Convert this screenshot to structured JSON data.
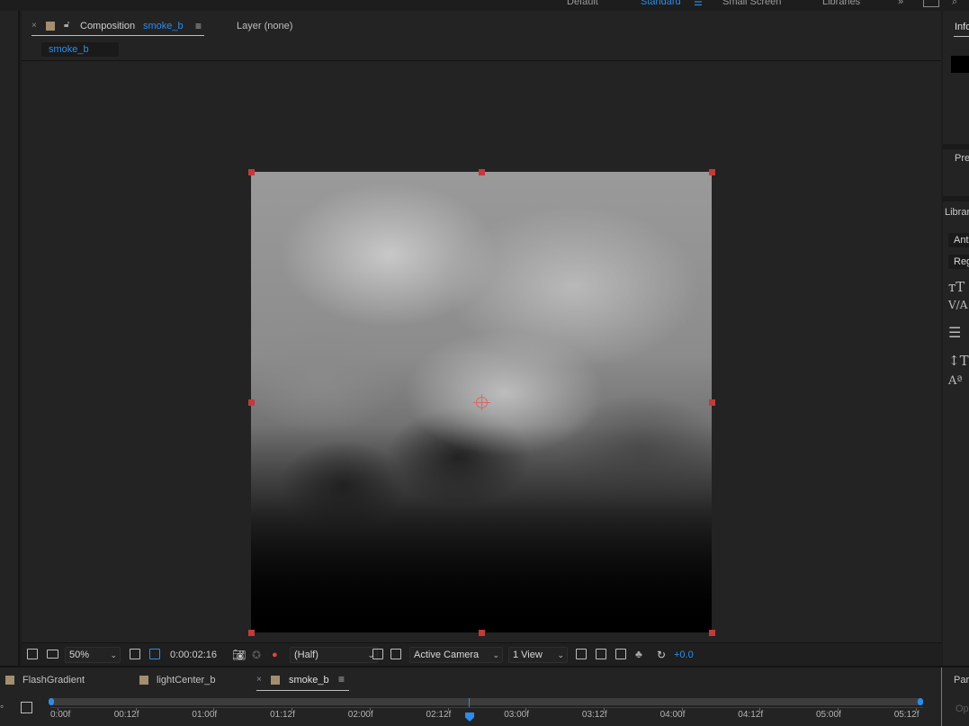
{
  "workspaces": [
    {
      "label": "Default",
      "active": false
    },
    {
      "label": "Standard",
      "active": true
    },
    {
      "label": "Small Screen",
      "active": false
    },
    {
      "label": "Libraries",
      "active": false
    }
  ],
  "comp_panel": {
    "tab_prefix": "Composition",
    "tab_comp_name": "smoke_b",
    "layer_tab": "Layer (none)",
    "subtab": "smoke_b"
  },
  "viewer_toolbar": {
    "zoom": "50%",
    "timecode": "0:00:02:16",
    "resolution": "(Half)",
    "camera": "Active Camera",
    "views": "1 View",
    "exposure": "+0.0"
  },
  "right_panel": {
    "info_label": "Info",
    "preview_label": "Preview",
    "libraries_label": "Libraries",
    "font_name": "Antic",
    "font_style": "Regular",
    "paragraph_label": "Paragraph",
    "paragraph_sub": "Op"
  },
  "timeline": {
    "tabs": [
      {
        "label": "FlashGradient",
        "active": false
      },
      {
        "label": "lightCenter_b",
        "active": false
      },
      {
        "label": "smoke_b",
        "active": true
      }
    ],
    "ruler_labels": [
      "0:00f",
      "00:12f",
      "01:00f",
      "01:12f",
      "02:00f",
      "02:12f",
      "03:00f",
      "03:12f",
      "04:00f",
      "04:12f",
      "05:00f",
      "05:12f"
    ]
  },
  "colors": {
    "accent": "#2d8ceb",
    "handle": "#c23a3a",
    "swatch": "#a38f6f"
  }
}
